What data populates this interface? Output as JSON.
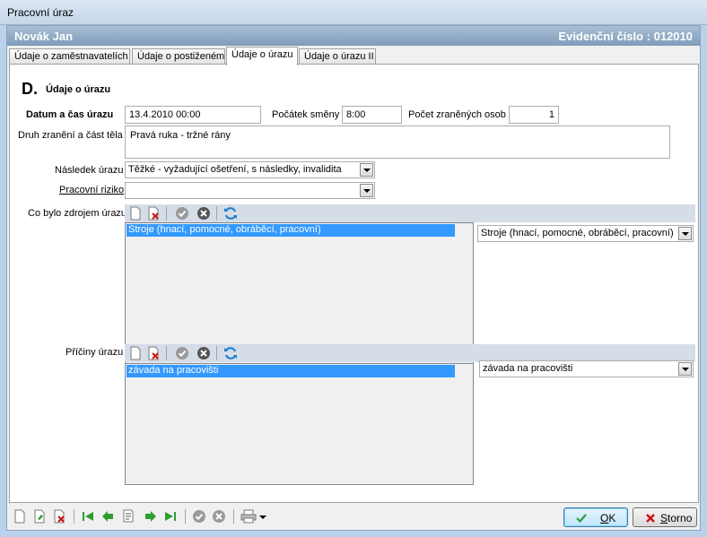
{
  "window": {
    "title": "Pracovní úraz"
  },
  "header": {
    "name": "Novák Jan",
    "evid": "Evidenční číslo : 012010"
  },
  "tabs": [
    {
      "label": "Údaje o zaměstnavatelích",
      "active": false
    },
    {
      "label": "Údaje o postiženém",
      "active": false
    },
    {
      "label": "Údaje o úrazu",
      "active": true
    },
    {
      "label": "Údaje o úrazu II",
      "active": false
    }
  ],
  "section": {
    "letter": "D.",
    "title": "Údaje o úrazu"
  },
  "form": {
    "datetime": {
      "label": "Datum a čas úrazu",
      "value": "13.4.2010 00:00"
    },
    "shift": {
      "label": "Počátek směny",
      "value": "8:00"
    },
    "injured": {
      "label": "Počet zraněných osob",
      "value": "1"
    },
    "injury": {
      "label": "Druh zranění a část těla",
      "value": "Pravá ruka  - tržné rány"
    },
    "consequence": {
      "label": "Následek úrazu",
      "value": "Těžké - vyžadující ošetření, s následky, invalidita"
    },
    "risk": {
      "label": "Pracovní riziko",
      "value": ""
    },
    "source": {
      "label": "Co bylo zdrojem úrazu",
      "item": "Stroje (hnací, pomocné, obráběcí, pracovní)",
      "selected": "Stroje (hnací, pomocné, obráběcí, pracovní)"
    },
    "causes": {
      "label": "Příčiny úrazu",
      "item": "závada na pracovišti",
      "selected": "závada na pracovišti"
    }
  },
  "buttons": {
    "ok_prefix": "",
    "ok_mn": "O",
    "ok_rest": "K",
    "storno_prefix": "",
    "storno_mn": "S",
    "storno_rest": "torno"
  },
  "colors": {
    "accent": "#3399ff",
    "header": "#8aa5c2",
    "strip": "#d5dde7"
  }
}
